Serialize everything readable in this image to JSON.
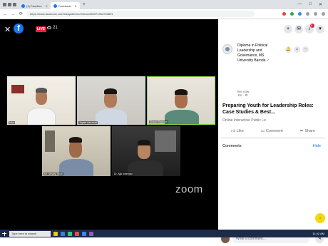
{
  "browser": {
    "tabs": [
      {
        "label": "(1) Faceboo"
      },
      {
        "label": "Facebook"
      }
    ],
    "new_tab": "+",
    "url": "https://www.facebook.com/lokoplatform/videos/282071953703891",
    "win_controls": [
      "—",
      "□",
      "✕"
    ]
  },
  "video": {
    "live_label": "LIVE",
    "viewer_count": "21",
    "watermark": "zoom",
    "participants": [
      {
        "name": "Nam"
      },
      {
        "name": "Jayant Aarumoli"
      },
      {
        "name": "Shashi Rajaram"
      },
      {
        "name": "Mr. Umang Modi"
      },
      {
        "name": "Dr. Ajai Indendar"
      }
    ]
  },
  "panel": {
    "notif_count": "5",
    "page_name": "Diploma in Political Leadership and Governance, MS University Baroda",
    "verified": "✓",
    "status": "live now.",
    "time": "1hr · ⚙",
    "title": "Preparing Youth for Leadership Roles: Case Studies & Best...",
    "subtitle": "Online Interactive Public Le",
    "like": "Like",
    "comment": "Comment",
    "share": "Share",
    "comments_label": "Comments",
    "hide": "Hide",
    "comment_placeholder": "Write a comment..."
  },
  "taskbar": {
    "search_placeholder": "Type here to search",
    "time": "11:42 AM"
  }
}
